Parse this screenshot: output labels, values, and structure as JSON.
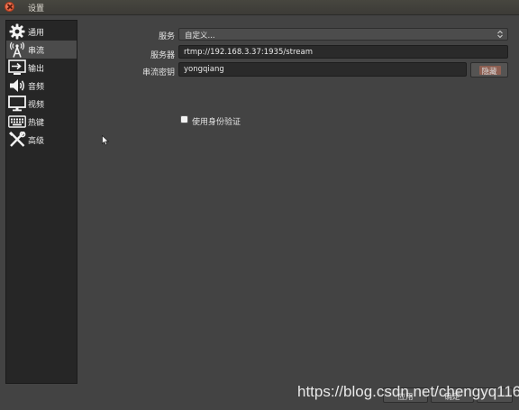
{
  "window": {
    "title": "设置"
  },
  "sidebar": {
    "items": [
      {
        "label": "通用",
        "icon": "gear-icon"
      },
      {
        "label": "串流",
        "icon": "broadcast-antenna-icon"
      },
      {
        "label": "输出",
        "icon": "output-icon"
      },
      {
        "label": "音频",
        "icon": "speaker-icon"
      },
      {
        "label": "视频",
        "icon": "monitor-icon"
      },
      {
        "label": "热键",
        "icon": "keyboard-icon"
      },
      {
        "label": "高级",
        "icon": "tools-icon"
      }
    ],
    "selected_index": 1
  },
  "stream": {
    "service_label": "服务",
    "service_value": "自定义...",
    "server_label": "服务器",
    "server_value": "rtmp://192.168.3.37:1935/stream",
    "key_label": "串流密钥",
    "key_value": "yongqiang",
    "hide_button": "隐藏",
    "auth_label": "使用身份验证",
    "auth_checked": false
  },
  "footer": {
    "apply_label": "应用",
    "ok_label": "确定"
  },
  "watermark": {
    "text": "https://blog.csdn.net/chengyq116"
  },
  "colors": {
    "selected_item_bg": "#4b4b4b",
    "hide_button_accent": "#8e5f52",
    "close_button": "#e0522c"
  }
}
